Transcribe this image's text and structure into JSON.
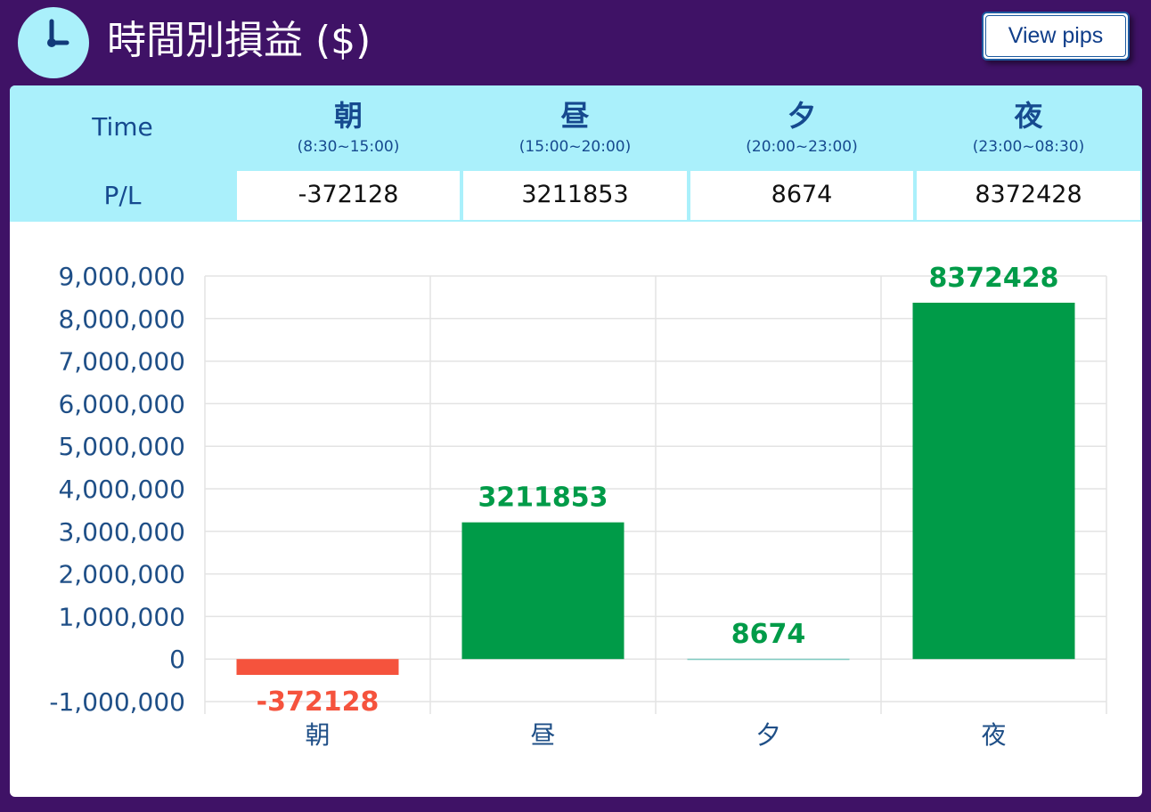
{
  "header": {
    "title": "時間別損益 ($)",
    "icon": "clock-icon",
    "view_pips_label": "View pips"
  },
  "table": {
    "row_label_time": "Time",
    "row_label_pl": "P/L",
    "periods": [
      {
        "name": "朝",
        "range": "(8:30~15:00)",
        "pl": "-372128"
      },
      {
        "name": "昼",
        "range": "(15:00~20:00)",
        "pl": "3211853"
      },
      {
        "name": "夕",
        "range": "(20:00~23:00)",
        "pl": "8674"
      },
      {
        "name": "夜",
        "range": "(23:00~08:30)",
        "pl": "8372428"
      }
    ]
  },
  "colors": {
    "background": "#3f1266",
    "header_cell": "#aaf0fb",
    "positive": "#009b48",
    "negative": "#f5533d",
    "axis_text": "#1f4f87",
    "grid": "#e3e3e3"
  },
  "chart_data": {
    "type": "bar",
    "categories": [
      "朝",
      "昼",
      "夕",
      "夜"
    ],
    "values": [
      -372128,
      3211853,
      8674,
      8372428
    ],
    "data_labels": [
      "-372128",
      "3211853",
      "8674",
      "8372428"
    ],
    "ylim": [
      -1000000,
      9000000
    ],
    "yticks": [
      9000000,
      8000000,
      7000000,
      6000000,
      5000000,
      4000000,
      3000000,
      2000000,
      1000000,
      0,
      -1000000
    ],
    "ytick_labels": [
      "9,000,000",
      "8,000,000",
      "7,000,000",
      "6,000,000",
      "5,000,000",
      "4,000,000",
      "3,000,000",
      "2,000,000",
      "1,000,000",
      "0",
      "-1,000,000"
    ],
    "grid": true,
    "legend": "none",
    "title": "",
    "xlabel": "",
    "ylabel": ""
  }
}
